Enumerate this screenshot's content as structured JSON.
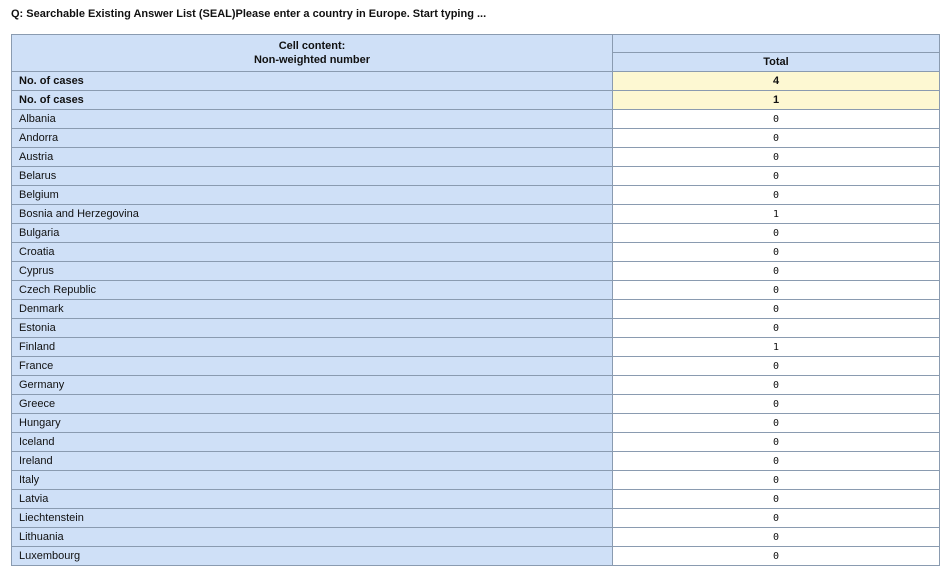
{
  "question": "Q: Searchable Existing Answer List (SEAL)Please enter a country in Europe. Start typing ...",
  "header": {
    "cell_content_title": "Cell content:",
    "cell_content_value": "Non-weighted number",
    "total_label": "Total"
  },
  "summary_rows": [
    {
      "label": "No. of cases",
      "value": "4"
    },
    {
      "label": "No. of cases",
      "value": "1"
    }
  ],
  "rows": [
    {
      "label": "Albania",
      "value": "0"
    },
    {
      "label": "Andorra",
      "value": "0"
    },
    {
      "label": "Austria",
      "value": "0"
    },
    {
      "label": "Belarus",
      "value": "0"
    },
    {
      "label": "Belgium",
      "value": "0"
    },
    {
      "label": "Bosnia and Herzegovina",
      "value": "1"
    },
    {
      "label": "Bulgaria",
      "value": "0"
    },
    {
      "label": "Croatia",
      "value": "0"
    },
    {
      "label": "Cyprus",
      "value": "0"
    },
    {
      "label": "Czech Republic",
      "value": "0"
    },
    {
      "label": "Denmark",
      "value": "0"
    },
    {
      "label": "Estonia",
      "value": "0"
    },
    {
      "label": "Finland",
      "value": "1"
    },
    {
      "label": "France",
      "value": "0"
    },
    {
      "label": "Germany",
      "value": "0"
    },
    {
      "label": "Greece",
      "value": "0"
    },
    {
      "label": "Hungary",
      "value": "0"
    },
    {
      "label": "Iceland",
      "value": "0"
    },
    {
      "label": "Ireland",
      "value": "0"
    },
    {
      "label": "Italy",
      "value": "0"
    },
    {
      "label": "Latvia",
      "value": "0"
    },
    {
      "label": "Liechtenstein",
      "value": "0"
    },
    {
      "label": "Lithuania",
      "value": "0"
    },
    {
      "label": "Luxembourg",
      "value": "0"
    }
  ],
  "colors": {
    "header_bg": "#cfe0f7",
    "summary_bg": "#fdf8d2",
    "border": "#8a9bb0"
  }
}
